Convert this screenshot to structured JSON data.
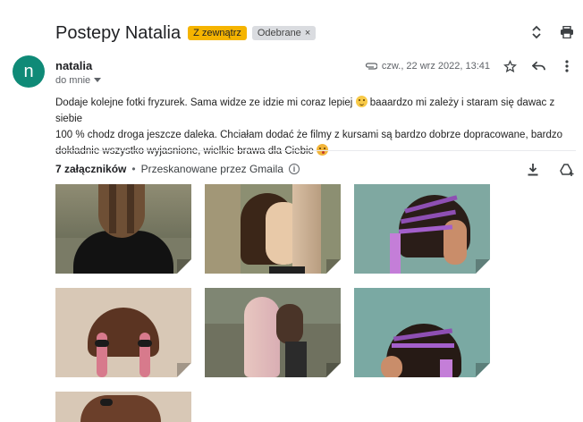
{
  "subject": "Postepy Natalia",
  "labels": [
    {
      "text": "Z zewnątrz",
      "color": "#f5b400"
    },
    {
      "text": "Odebrane",
      "color": "#dadce0"
    }
  ],
  "label_remove": "×",
  "sender": {
    "initial": "n",
    "name": "natalia",
    "recipient": "do mnie",
    "avatar_color": "#0f8a77"
  },
  "date": "czw., 22 wrz 2022, 13:41",
  "body": {
    "line1": "Dodaje kolejne fotki fryzurek. Sama widze ze idzie mi coraz lepiej",
    "line1b": " baaardzo mi zależy i staram się dawac z siebie",
    "line2": "100 % chodz droga jeszcze daleka. Chciałam dodać że filmy z kursami są bardzo dobrze dopracowane, bardzo",
    "line3": "dokładnie wszystko wyjasnione, wielkie brawa dla Ciebie"
  },
  "attachments": {
    "count_label": "7 załączników",
    "separator": "•",
    "scan_label": "Przeskanowane przez Gmaila",
    "info_glyph": "i",
    "items": [
      {
        "name": "photo-1"
      },
      {
        "name": "photo-2"
      },
      {
        "name": "photo-3"
      },
      {
        "name": "photo-4"
      },
      {
        "name": "photo-5"
      },
      {
        "name": "photo-6"
      },
      {
        "name": "photo-7"
      }
    ]
  }
}
